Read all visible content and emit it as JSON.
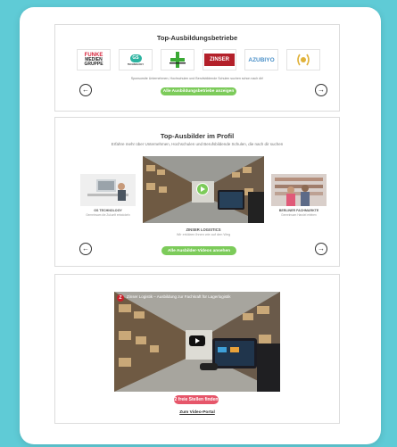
{
  "colors": {
    "background": "#5fcbd6",
    "accent_green": "#7ccb5a",
    "accent_red": "#e6566a"
  },
  "section1": {
    "title": "Top-Ausbildungsbetriebe",
    "logos": [
      {
        "name": "FUNKE MEDIEN GRUPPE",
        "line1": "FUNKE",
        "line2": "MEDIEN",
        "line3": "GRUPPE"
      },
      {
        "name": "GS Technology",
        "badge": "GS",
        "text": "TECHNOLOGY"
      },
      {
        "name": "green-logo"
      },
      {
        "name": "ZINSER",
        "text": "ZINSER"
      },
      {
        "name": "AZUBIYO",
        "text": "AZUBIYO"
      },
      {
        "name": "award-logo"
      }
    ],
    "sponsor_text": "Sponsorsite Unternehmen, Hochschulen und Berufsbildende Schulen suchen schon nach dir!",
    "button_label": "Alle Ausbildungsbetriebe anzeigen",
    "prev_icon": "arrow-left-icon",
    "next_icon": "arrow-right-icon"
  },
  "section2": {
    "title": "Top-Ausbilder im Profil",
    "subtitle": "Erfahre mehr über Unternehmen, Hochschulen und Berufsbildende Schulen, die nach dir suchen",
    "left_card": {
      "name": "GS TECHNOLOGY",
      "caption": "Gemeinsam die Zukunft entwickeln"
    },
    "center_card": {
      "name": "ZINSER LOGISTICS",
      "caption": "Wir erklären Ihnen wie auf den Weg"
    },
    "right_card": {
      "name": "BERLINER FACHMARKTE",
      "caption": "Gemeinsam Handel erleben"
    },
    "button_label": "Alle Ausbilder-Videos ansehen"
  },
  "section3": {
    "video_title": "Zinser Logistik – Ausbildung zur Fachkraft für Lagerlogistik",
    "button_label": "2 freie Stellen finden",
    "link_label": "Zum Video-Portal"
  }
}
